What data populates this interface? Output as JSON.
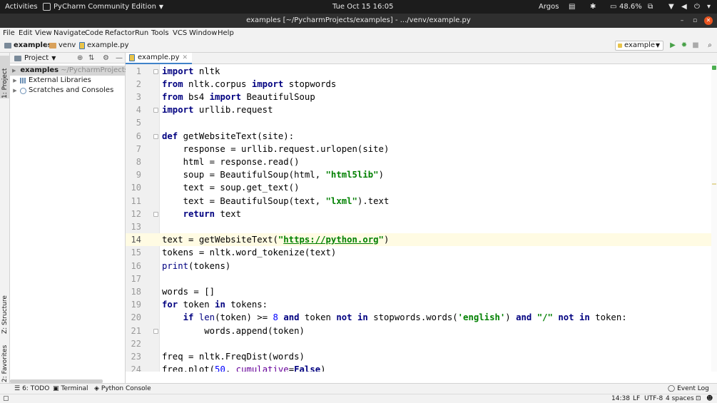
{
  "system_bar": {
    "activities": "Activities",
    "app_name": "PyCharm Community Edition",
    "clock": "Tue Oct 15  16:05",
    "user": "Argos",
    "battery": "48.6%"
  },
  "window": {
    "title": "examples [~/PycharmProjects/examples] - .../venv/example.py"
  },
  "menu": {
    "items": [
      "File",
      "Edit",
      "View",
      "Navigate",
      "Code",
      "Refactor",
      "Run",
      "Tools",
      "VCS",
      "Window",
      "Help"
    ]
  },
  "navigation": {
    "crumbs": [
      "examples",
      "venv",
      "example.py"
    ],
    "run_config": "example"
  },
  "tool_windows": {
    "left": [
      "1: Project",
      "Z: Structure",
      "2: Favorites"
    ],
    "bottom": [
      "6: TODO",
      "Terminal",
      "Python Console"
    ],
    "event_log": "Event Log"
  },
  "project_panel": {
    "title": "Project",
    "tree": [
      {
        "label": "examples",
        "path": "~/PycharmProjects/e"
      },
      {
        "label": "External Libraries"
      },
      {
        "label": "Scratches and Consoles"
      }
    ]
  },
  "editor": {
    "tab": "example.py",
    "current_line": 14,
    "lines": [
      "import nltk",
      "from nltk.corpus import stopwords",
      "from bs4 import BeautifulSoup",
      "import urllib.request",
      "",
      "def getWebsiteText(site):",
      "    response = urllib.request.urlopen(site)",
      "    html = response.read()",
      "    soup = BeautifulSoup(html, \"html5lib\")",
      "    text = soup.get_text()",
      "    text = BeautifulSoup(text, \"lxml\").text",
      "    return text",
      "",
      "text = getWebsiteText(\"https://python.org\")",
      "tokens = nltk.word_tokenize(text)",
      "print(tokens)",
      "",
      "words = []",
      "for token in tokens:",
      "    if len(token) >= 8 and token not in stopwords.words('english') and \"/\" not in token:",
      "        words.append(token)",
      "",
      "freq = nltk.FreqDist(words)",
      "freq.plot(50, cumulative=False)"
    ]
  },
  "status": {
    "position": "14:38",
    "line_separator": "LF",
    "encoding": "UTF-8",
    "indent": "4 spaces"
  }
}
